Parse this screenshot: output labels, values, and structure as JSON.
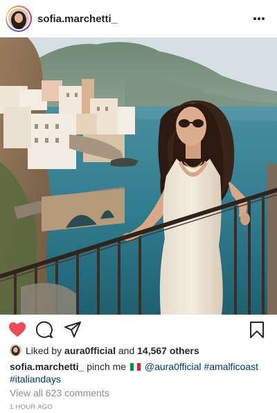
{
  "header": {
    "username": "sofia.marchetti_",
    "more_icon": "more-horizontal-icon"
  },
  "photo": {
    "subject": "woman-at-railing-amalfi-coast"
  },
  "actions": {
    "liked": true,
    "icons": [
      "heart-filled-icon",
      "comment-icon",
      "share-icon",
      "bookmark-icon"
    ],
    "like_color": "#ed4956"
  },
  "likes": {
    "prefix": "Liked by",
    "user": "aura0fficial",
    "middle": "and",
    "others": "14,567 others"
  },
  "caption": {
    "username": "sofia.marchetti_",
    "text": "pinch me",
    "flag": "italy-flag",
    "mention": "@aura0fficial",
    "hashtag1": "#amalficoast",
    "hashtag2": "#italiandays"
  },
  "comments_link": "View all 623 comments",
  "timestamp": "1 HOUR AGO"
}
